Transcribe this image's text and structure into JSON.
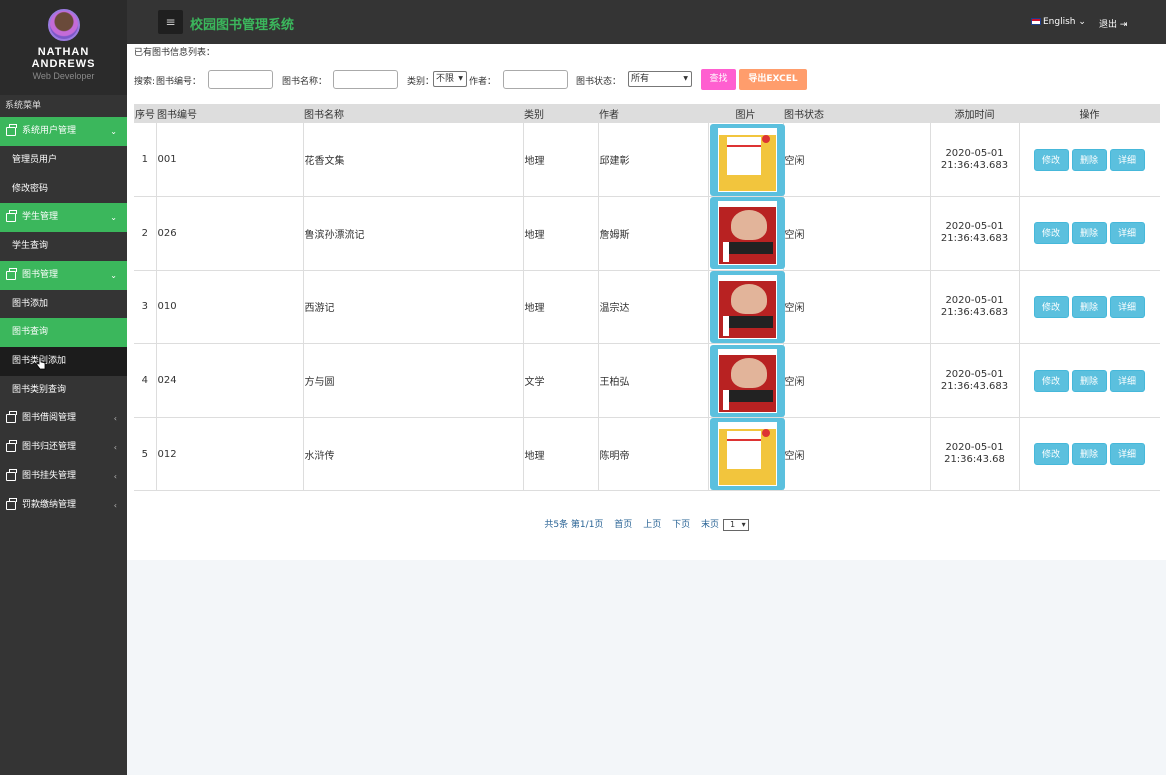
{
  "profile": {
    "name_line1": "NATHAN",
    "name_line2": "ANDREWS",
    "role": "Web Developer"
  },
  "sidebar": {
    "heading": "系统菜单",
    "groups": [
      {
        "label": "系统用户管理",
        "open": true,
        "items": [
          "管理员用户",
          "修改密码"
        ]
      },
      {
        "label": "学生管理",
        "open": true,
        "items": [
          "学生查询"
        ]
      },
      {
        "label": "图书管理",
        "open": true,
        "items": [
          "图书添加",
          "图书查询",
          "图书类别添加",
          "图书类别查询"
        ]
      },
      {
        "label": "图书借阅管理",
        "open": false
      },
      {
        "label": "图书归还管理",
        "open": false
      },
      {
        "label": "图书挂失管理",
        "open": false
      },
      {
        "label": "罚款缴纳管理",
        "open": false
      }
    ],
    "active_item": "图书查询",
    "hover_item": "图书类别添加"
  },
  "header": {
    "menu_icon": "≡",
    "title": "校园图书管理系统",
    "language": "English",
    "logout": "退出"
  },
  "list_title": "已有图书信息列表：",
  "search": {
    "label": "搜索:",
    "book_no_label": "图书编号：",
    "book_name_label": "图书名称：",
    "category_label": "类别：",
    "category_value": "不限",
    "author_label": "作者：",
    "status_label": "图书状态：",
    "status_value": "所有",
    "search_button": "查找",
    "export_button": "导出EXCEL"
  },
  "table": {
    "headers": [
      "序号",
      "图书编号",
      "图书名称",
      "类别",
      "作者",
      "图片",
      "图书状态",
      "添加时间",
      "操作"
    ],
    "rows": [
      {
        "seq": "1",
        "no": "001",
        "name": "花香文集",
        "category": "地理",
        "author": "邱建彰",
        "cover": "yellow",
        "status": "空闲",
        "date": "2020-05-01",
        "time": "21:36:43.683"
      },
      {
        "seq": "2",
        "no": "026",
        "name": "鲁滨孙漂流记",
        "category": "地理",
        "author": "詹姆斯",
        "cover": "red",
        "status": "空闲",
        "date": "2020-05-01",
        "time": "21:36:43.683"
      },
      {
        "seq": "3",
        "no": "010",
        "name": "西游记",
        "category": "地理",
        "author": "温宗达",
        "cover": "red",
        "status": "空闲",
        "date": "2020-05-01",
        "time": "21:36:43.683"
      },
      {
        "seq": "4",
        "no": "024",
        "name": "方与圆",
        "category": "文学",
        "author": "王柏弘",
        "cover": "red",
        "status": "空闲",
        "date": "2020-05-01",
        "time": "21:36:43.683"
      },
      {
        "seq": "5",
        "no": "012",
        "name": "水浒传",
        "category": "地理",
        "author": "陈明帝",
        "cover": "yellow",
        "status": "空闲",
        "date": "2020-05-01",
        "time": "21:36:43.68"
      }
    ],
    "actions": {
      "edit": "修改",
      "delete": "删除",
      "detail": "详细"
    }
  },
  "pager": {
    "summary": "共5条 第1/1页",
    "first": "首页",
    "prev": "上页",
    "next": "下页",
    "last": "末页",
    "page_select": "1"
  },
  "colors": {
    "accent_green": "#3bb75c",
    "sidebar_bg": "#343434",
    "action_blue": "#5bc0de",
    "search_pink": "#ff5fd0",
    "export_orange": "#ff9d6c"
  }
}
